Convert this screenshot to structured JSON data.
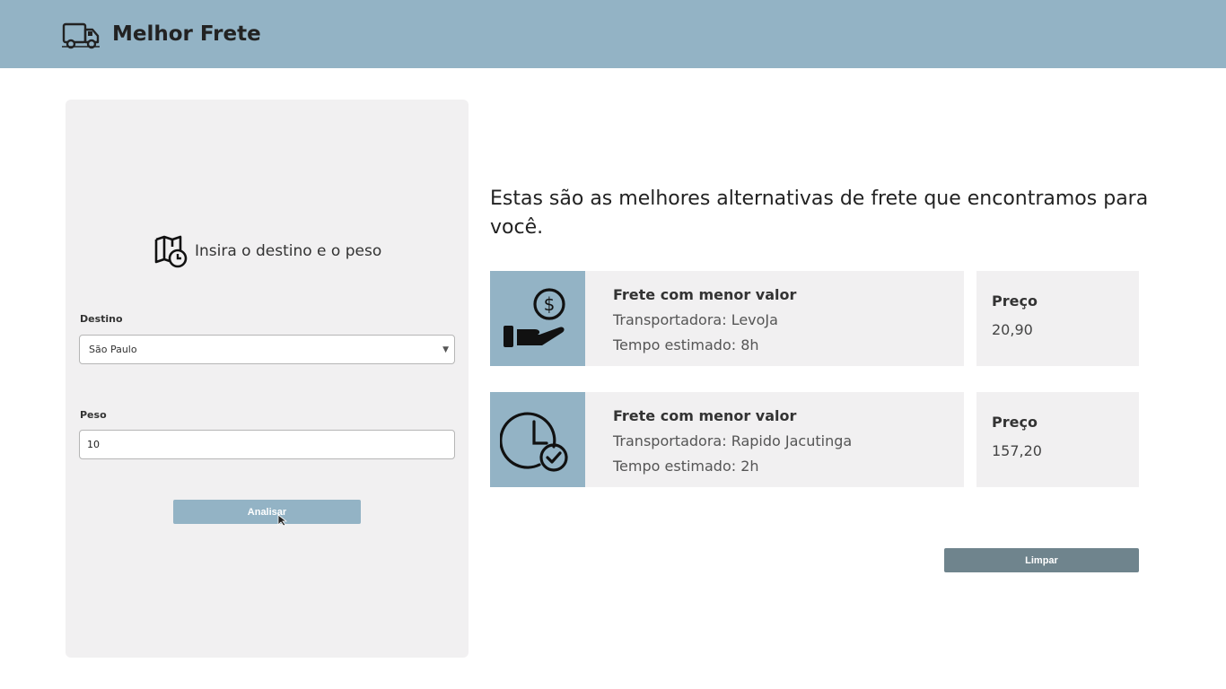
{
  "header": {
    "title": "Melhor Frete",
    "logo_icon": "delivery-truck-icon",
    "background": "#93b3c5"
  },
  "form": {
    "heading": "Insira o destino e o peso",
    "heading_icon": "map-clock-icon",
    "destino_label": "Destino",
    "destino_value": "São Paulo",
    "peso_label": "Peso",
    "peso_value": "10",
    "submit_label": "Analisar"
  },
  "results": {
    "title": "Estas são as melhores alternativas de frete que encontramos para você.",
    "items": [
      {
        "icon": "hand-money-icon",
        "title": "Frete com menor valor",
        "carrier": "Transportadora: LevoJa",
        "time": "Tempo estimado: 8h",
        "price_label": "Preço",
        "price": "20,90"
      },
      {
        "icon": "clock-check-icon",
        "title": "Frete com menor valor",
        "carrier": "Transportadora: Rapido Jacutinga",
        "time": "Tempo estimado: 2h",
        "price_label": "Preço",
        "price": "157,20"
      }
    ],
    "clear_label": "Limpar"
  },
  "colors": {
    "accent": "#93b3c5",
    "panel": "#f1f0f1",
    "clear_button": "#6f848d"
  }
}
